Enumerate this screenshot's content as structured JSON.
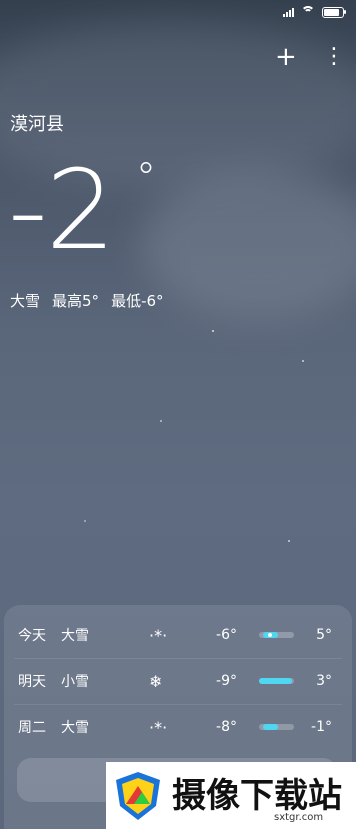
{
  "status": {
    "icons": [
      "signal-icon",
      "wifi-icon",
      "battery-icon"
    ]
  },
  "topbar": {
    "add_icon": "plus-icon",
    "more_icon": "more-vertical-icon",
    "add_glyph": "+",
    "more_glyph": "⋮"
  },
  "weather": {
    "city": "漠河县",
    "temperature": "-2",
    "degree": "°",
    "condition": "大雪",
    "high": "最高5°",
    "low": "最低-6°"
  },
  "forecast": [
    {
      "day": "今天",
      "desc": "大雪",
      "icon": "heavy-snow-icon",
      "glyph": "·*·",
      "low": "-6°",
      "high": "5°",
      "range": [
        0.12,
        0.55
      ],
      "now": 0.3
    },
    {
      "day": "明天",
      "desc": "小雪",
      "icon": "snowflake-icon",
      "glyph": "❄",
      "low": "-9°",
      "high": "3°",
      "range": [
        0.0,
        0.95
      ]
    },
    {
      "day": "周二",
      "desc": "大雪",
      "icon": "heavy-snow-icon",
      "glyph": "·*·",
      "low": "-8°",
      "high": "-1°",
      "range": [
        0.12,
        0.55
      ]
    }
  ],
  "watermark": {
    "title": "摄像下载站",
    "site": "sxtgr.com"
  }
}
